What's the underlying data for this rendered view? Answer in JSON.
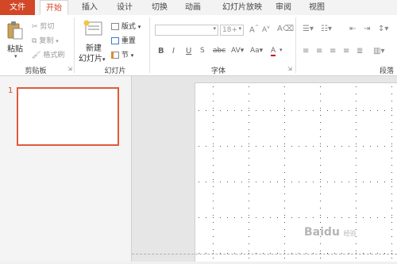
{
  "tabs": [
    {
      "label": "文件",
      "key": "file"
    },
    {
      "label": "开始",
      "key": "home"
    },
    {
      "label": "插入",
      "key": "insert"
    },
    {
      "label": "设计",
      "key": "design"
    },
    {
      "label": "切换",
      "key": "transitions"
    },
    {
      "label": "动画",
      "key": "animations"
    },
    {
      "label": "幻灯片放映",
      "key": "slideshow"
    },
    {
      "label": "审阅",
      "key": "review"
    },
    {
      "label": "视图",
      "key": "view"
    }
  ],
  "clipboard": {
    "paste": "粘贴",
    "cut": "剪切",
    "copy": "复制",
    "format_painter": "格式刷",
    "group_label": "剪贴板"
  },
  "slides_group": {
    "new_slide_line1": "新建",
    "new_slide_line2": "幻灯片",
    "layout": "版式",
    "reset": "重置",
    "section": "节",
    "group_label": "幻灯片"
  },
  "font_group": {
    "font_name": "",
    "font_size": "18+",
    "group_label": "字体"
  },
  "paragraph_group": {
    "group_label": "段落"
  },
  "slide_panel": {
    "slide_number": "1"
  },
  "watermark": {
    "text": "Baidu",
    "sub": "经验"
  },
  "colors": {
    "accent": "#d24726",
    "thumb_border": "#e05a3a"
  }
}
